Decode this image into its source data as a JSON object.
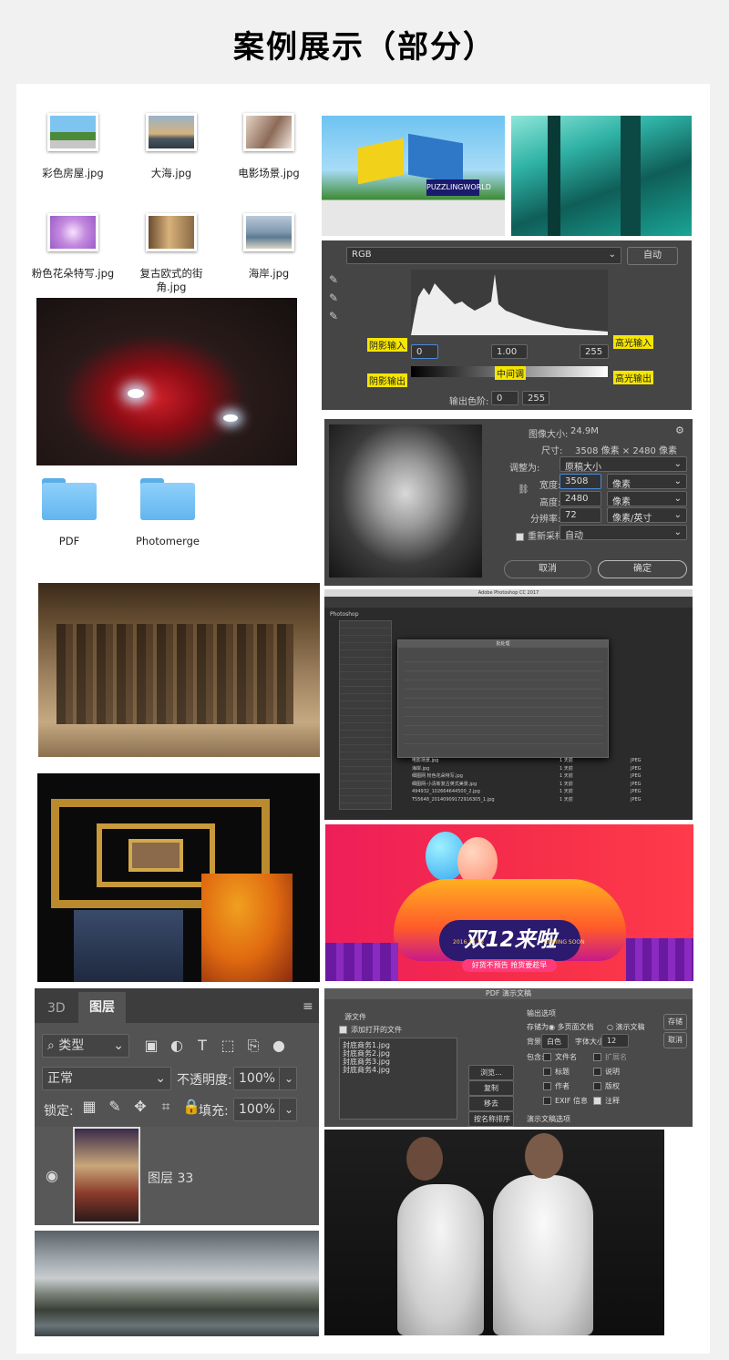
{
  "header": {
    "title": "案例展示（部分）"
  },
  "files": [
    {
      "name": "彩色房屋.jpg"
    },
    {
      "name": "大海.jpg"
    },
    {
      "name": "电影场景.jpg"
    },
    {
      "name": "粉色花朵特写.jpg"
    },
    {
      "name": "复古欧式的街角.jpg"
    },
    {
      "name": "海岸.jpg"
    }
  ],
  "folders": [
    {
      "name": "PDF"
    },
    {
      "name": "Photomerge"
    }
  ],
  "levels": {
    "channel": "RGB",
    "auto": "自动",
    "shadow_in": "阴影输入",
    "highlight_in": "高光输入",
    "midtone": "中间调",
    "shadow_out": "阴影输出",
    "highlight_out": "高光输出",
    "in_black": "0",
    "in_gamma": "1.00",
    "in_white": "255",
    "output_label": "输出色阶:",
    "out_black": "0",
    "out_white": "255"
  },
  "image_size": {
    "size_label": "图像大小:",
    "size_value": "24.9M",
    "dims_label": "尺寸:",
    "dims_value": "3508 像素 × 2480 像素",
    "fit_label": "调整为:",
    "fit_value": "原稿大小",
    "width_label": "宽度:",
    "width_value": "3508",
    "height_label": "高度:",
    "height_value": "2480",
    "res_label": "分辨率:",
    "res_value": "72",
    "unit_px": "像素",
    "unit_res": "像素/英寸",
    "resample_label": "重新采样:",
    "resample_value": "自动",
    "cancel": "取消",
    "ok": "确定"
  },
  "ps_window": {
    "app_title": "Adobe Photoshop CC 2017",
    "app_name": "Photoshop",
    "dialog_title": "批处理",
    "files": [
      "电影场景.jpg",
      "海岸.jpg",
      "细图网 粉色花朵特写.jpg",
      "细图网-小清新复古英式美景.jpg",
      "494932_102664644500_2.jpg",
      "T55648_20140909172916305_1.jpg"
    ],
    "sizes": [
      "1 天前",
      "1 天前",
      "1 天前",
      "1 天前",
      "1 天前",
      "1 天前"
    ],
    "types": [
      "JPEG",
      "JPEG",
      "JPEG",
      "JPEG",
      "JPEG",
      "JPEG"
    ]
  },
  "banner": {
    "main": "双12来啦",
    "sub": "COMING SOON",
    "date": "2016.12.12",
    "pill": "好货不预告 抢货要趁早"
  },
  "layers": {
    "tab_3d": "3D",
    "tab_layers": "图层",
    "filter": "类型",
    "blend": "正常",
    "opacity_label": "不透明度:",
    "opacity_value": "100%",
    "lock_label": "锁定:",
    "fill_label": "填充:",
    "fill_value": "100%",
    "layer_name": "图层 33"
  },
  "pdf_dialog": {
    "title": "PDF 演示文稿",
    "source": "源文件",
    "add_open": "添加打开的文件",
    "files": [
      "封底商务1.jpg",
      "封底商务2.jpg",
      "封底商务3.jpg",
      "封底商务4.jpg"
    ],
    "browse": "浏览...",
    "duplicate": "复制",
    "remove": "移去",
    "sort": "按名称排序",
    "output_options": "输出选项",
    "save_as": "存储为:",
    "multi_page": "多页面文档",
    "presentation": "演示文稿",
    "bg_label": "背景:",
    "bg_value": "白色",
    "font_label": "字体大小:",
    "font_value": "12",
    "include": "包含:",
    "opt_filename": "文件名",
    "opt_ext": "扩展名",
    "opt_title": "标题",
    "opt_desc": "说明",
    "opt_author": "作者",
    "opt_copyright": "版权",
    "opt_exif": "EXIF 信息",
    "opt_notes": "注释",
    "presentation_options": "演示文稿选项",
    "save_btn": "存储",
    "cancel_btn": "取消"
  }
}
